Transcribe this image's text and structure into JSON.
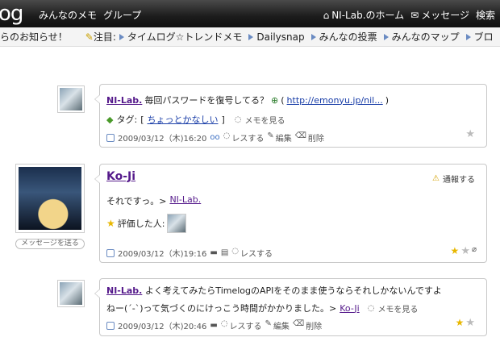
{
  "header": {
    "logo": "og",
    "nav_left": [
      "みんなのメモ",
      "グループ"
    ],
    "home": "NI-Lab.のホーム",
    "messages": "メッセージ",
    "search": "検索"
  },
  "ticker": {
    "notice": "らのお知らせ！",
    "attention": "注目:",
    "links": [
      "タイムログ☆トレンドメモ",
      "Dailysnap",
      "みんなの投票",
      "みんなのマップ",
      "ブロ"
    ]
  },
  "posts": [
    {
      "user": "NI-Lab.",
      "text": "毎回パスワードを復号してる？",
      "link": "http://emonyu.jp/nil...",
      "tag_label": "タグ:",
      "tag": "ちょっとかなしい",
      "see_memo": "メモを見る",
      "time": "2009/03/12（木)16:20",
      "reply": "レスする",
      "edit": "編集",
      "delete": "削除"
    },
    {
      "user": "Ko-Ji",
      "report": "通報する",
      "text": "それですっ。>",
      "reply_to": "NI-Lab.",
      "rated_label": "評価した人:",
      "send_message": "メッセージを送る",
      "time": "2009/03/12（木)19:16",
      "reply": "レスする"
    },
    {
      "user": "NI-Lab.",
      "line1": "よく考えてみたらTimelogのAPIをそのまま使うならそれしかないんですよ",
      "line2": "ねー(´-`)って気づくのにけっこう時間がかかりました。>",
      "reply_to": "Ko-Ji",
      "see_memo": "メモを見る",
      "time": "2009/03/12（木)20:46",
      "reply": "レスする",
      "edit": "編集",
      "delete": "削除"
    }
  ]
}
